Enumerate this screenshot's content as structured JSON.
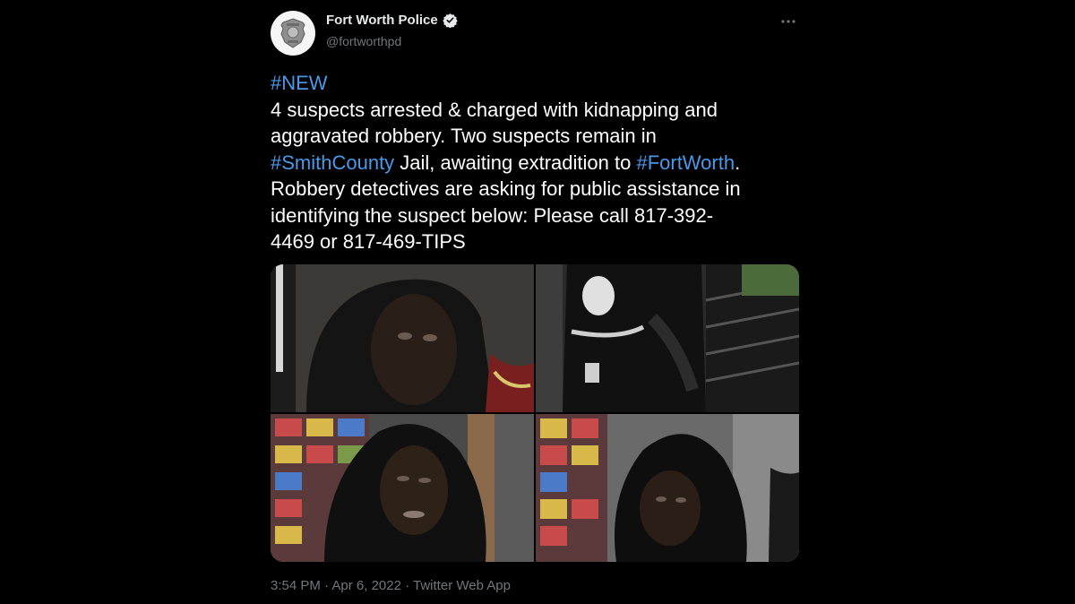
{
  "author": {
    "name": "Fort Worth Police",
    "handle": "@fortworthpd",
    "verified": true,
    "avatar_icon": "police-badge-icon"
  },
  "more_icon": "more-options-icon",
  "tweet": {
    "hashtag_new": "#NEW",
    "line1": "4 suspects arrested & charged with kidnapping and",
    "line2": "aggravated robbery. Two suspects remain in",
    "hashtag_smith": "#SmithCounty",
    "line3_mid": " Jail, awaiting extradition to ",
    "hashtag_fw": "#FortWorth",
    "line3_end": ".",
    "line4": "Robbery detectives are asking for public assistance in",
    "line5": "identifying the suspect below: Please call 817-392-",
    "line6": "4469 or 817-469-TIPS"
  },
  "meta": {
    "time": "3:54 PM",
    "sep1": " · ",
    "date": "Apr 6, 2022",
    "sep2": " · ",
    "source": "Twitter Web App"
  },
  "colors": {
    "background": "#000000",
    "text": "#ffffff",
    "link": "#4a99e9",
    "secondary": "#71767b"
  }
}
